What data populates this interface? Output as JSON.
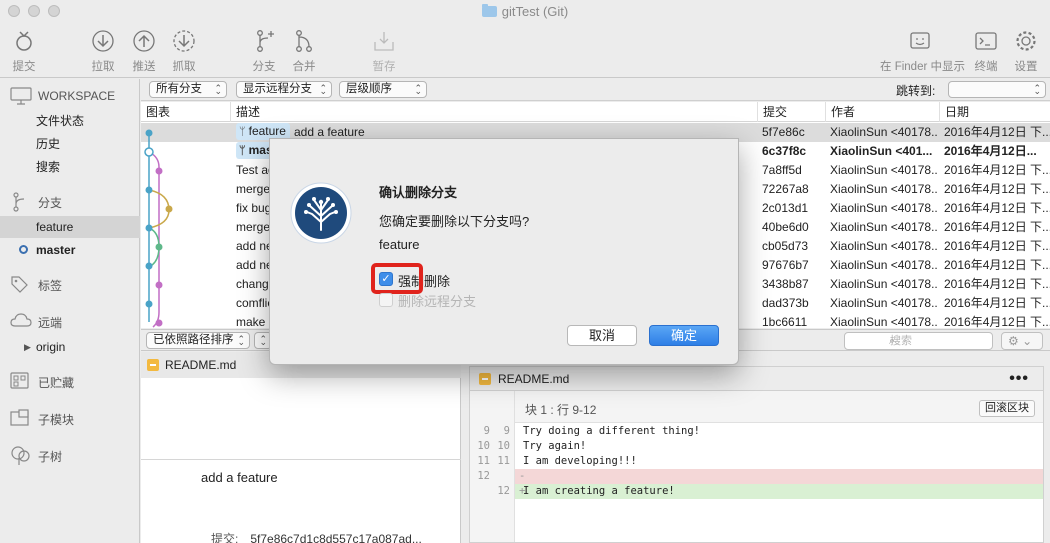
{
  "window": {
    "title": "gitTest (Git)"
  },
  "toolbar": {
    "commit": "提交",
    "pull": "拉取",
    "push": "推送",
    "fetch": "抓取",
    "branch": "分支",
    "merge": "合并",
    "stash": "暂存",
    "finder": "在 Finder 中显示",
    "terminal": "终端",
    "settings": "设置"
  },
  "sidebar": {
    "workspace": "WORKSPACE",
    "workspace_items": [
      "文件状态",
      "历史",
      "搜索"
    ],
    "branches_title": "分支",
    "branches": [
      "feature",
      "master"
    ],
    "tags_title": "标签",
    "remotes_title": "远端",
    "remote_origin": "origin",
    "stashes_title": "已贮藏",
    "submodules_title": "子模块",
    "subtrees_title": "子树"
  },
  "filterbar": {
    "all_branches": "所有分支",
    "show_remote": "显示远程分支",
    "order": "层级顺序",
    "jump_to": "跳转到:"
  },
  "table": {
    "headers": [
      "图表",
      "描述",
      "提交",
      "作者",
      "日期"
    ],
    "rows": [
      {
        "tag": "feature",
        "desc": "add a feature",
        "hash": "5f7e86c",
        "author": "XiaolinSun <40178...",
        "date": "2016年4月12日 下..."
      },
      {
        "tag": "mas",
        "desc": "",
        "hash": "6c37f8c",
        "author": "XiaolinSun <401...",
        "date": "2016年4月12日..."
      },
      {
        "tag": "",
        "desc": "Test ag",
        "hash": "7a8ff5d",
        "author": "XiaolinSun <40178...",
        "date": "2016年4月12日 下..."
      },
      {
        "tag": "",
        "desc": "merge",
        "hash": "72267a8",
        "author": "XiaolinSun <40178...",
        "date": "2016年4月12日 下..."
      },
      {
        "tag": "",
        "desc": "fix bug",
        "hash": "2c013d1",
        "author": "XiaolinSun <40178...",
        "date": "2016年4月12日 下..."
      },
      {
        "tag": "",
        "desc": "merge",
        "hash": "40be6d0",
        "author": "XiaolinSun <40178...",
        "date": "2016年4月12日 下..."
      },
      {
        "tag": "",
        "desc": "add ne",
        "hash": "cb05d73",
        "author": "XiaolinSun <40178...",
        "date": "2016年4月12日 下..."
      },
      {
        "tag": "",
        "desc": "add ne",
        "hash": "97676b7",
        "author": "XiaolinSun <40178...",
        "date": "2016年4月12日 下..."
      },
      {
        "tag": "",
        "desc": "change",
        "hash": "3438b87",
        "author": "XiaolinSun <40178...",
        "date": "2016年4月12日 下..."
      },
      {
        "tag": "",
        "desc": "comflic",
        "hash": "dad373b",
        "author": "XiaolinSun <40178...",
        "date": "2016年4月12日 下..."
      },
      {
        "tag": "",
        "desc": "make a",
        "hash": "1bc6611",
        "author": "XiaolinSun <40178...",
        "date": "2016年4月12日 下..."
      }
    ]
  },
  "lower": {
    "sort": "已依照路径排序",
    "search_placeholder": "搜索",
    "file": "README.md",
    "commit_message": "add a feature",
    "commit_label": "提交:",
    "commit_hash": "5f7e86c7d1c8d557c17a087ad..."
  },
  "diff": {
    "file": "README.md",
    "hunk": "块 1 : 行 9-12",
    "revert": "回滚区块",
    "lines": [
      {
        "n1": "9",
        "n2": "9",
        "sign": "",
        "text": "Try doing a different thing!",
        "kind": "ctx"
      },
      {
        "n1": "10",
        "n2": "10",
        "sign": "",
        "text": "Try again!",
        "kind": "ctx"
      },
      {
        "n1": "11",
        "n2": "11",
        "sign": "",
        "text": "I am developing!!!",
        "kind": "ctx"
      },
      {
        "n1": "12",
        "n2": "",
        "sign": "-",
        "text": "",
        "kind": "del"
      },
      {
        "n1": "",
        "n2": "12",
        "sign": "+",
        "text": "I am creating a feature!",
        "kind": "add"
      }
    ]
  },
  "dialog": {
    "title": "确认删除分支",
    "question": "您确定要删除以下分支吗?",
    "branch": "feature",
    "force_delete": "强制删除",
    "force_delete_checked": true,
    "delete_remote": "删除远程分支",
    "delete_remote_enabled": false,
    "cancel": "取消",
    "ok": "确定"
  },
  "colors": {
    "accent": "#2e7fe6",
    "highlight": "#e0231c",
    "tag_bg": "#cfe6f7"
  }
}
